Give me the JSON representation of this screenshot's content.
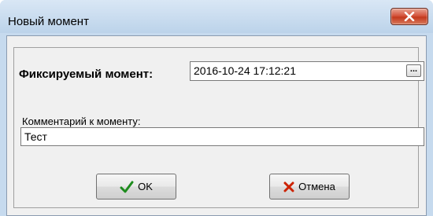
{
  "window": {
    "title": "Новый момент",
    "close_icon": "close-icon",
    "close_color": "#c4391d"
  },
  "form": {
    "moment_label": "Фиксируемый момент:",
    "moment_value": "2016-10-24 17:12:21",
    "ellipsis_label": "...",
    "comment_label": "Комментарий к моменту:",
    "comment_value": "Тест"
  },
  "buttons": {
    "ok_label": "OK",
    "ok_icon": "checkmark-icon",
    "ok_icon_color": "#1e8c1e",
    "cancel_label": "Отмена",
    "cancel_icon": "cross-icon",
    "cancel_icon_color": "#cc2200"
  }
}
